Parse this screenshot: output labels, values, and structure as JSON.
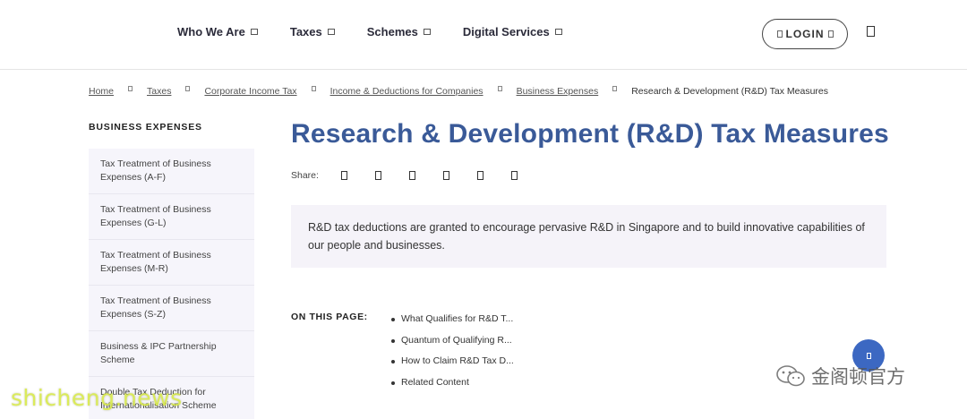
{
  "header": {
    "nav": [
      {
        "label": "Who We Are"
      },
      {
        "label": "Taxes"
      },
      {
        "label": "Schemes"
      },
      {
        "label": "Digital Services"
      }
    ],
    "login_label": "LOGIN"
  },
  "breadcrumb": {
    "items": [
      "Home",
      "Taxes",
      "Corporate Income Tax",
      "Income & Deductions for Companies",
      "Business Expenses"
    ],
    "current": "Research & Development (R&D) Tax Measures"
  },
  "sidebar": {
    "title": "BUSINESS EXPENSES",
    "items": [
      {
        "label": "Tax Treatment of Business Expenses (A-F)"
      },
      {
        "label": "Tax Treatment of Business Expenses (G-L)"
      },
      {
        "label": "Tax Treatment of Business Expenses (M-R)"
      },
      {
        "label": "Tax Treatment of Business Expenses (S-Z)"
      },
      {
        "label": "Business & IPC Partnership Scheme"
      },
      {
        "label": "Double Tax Deduction for Internationalisation Scheme"
      }
    ]
  },
  "main": {
    "title": "Research & Development (R&D) Tax Measures",
    "share_label": "Share:",
    "share_icons": [
      "facebook-icon",
      "twitter-icon",
      "linkedin-icon",
      "whatsapp-icon",
      "email-icon",
      "print-icon"
    ],
    "intro": "R&D tax deductions are granted to encourage pervasive R&D in Singapore and to build innovative capabilities of our people and businesses.",
    "on_this_page_label": "ON THIS PAGE:",
    "on_this_page": [
      "What Qualifies for R&D T...",
      "Quantum of Qualifying R...",
      "How to Claim R&D Tax D...",
      "Related Content"
    ]
  },
  "watermarks": {
    "brand": "金阁顿官方",
    "site": "shicheng.news"
  },
  "colors": {
    "title_blue": "#3a5a98",
    "fab_blue": "#3c68c2",
    "panel_bg": "#f5f3f9"
  }
}
